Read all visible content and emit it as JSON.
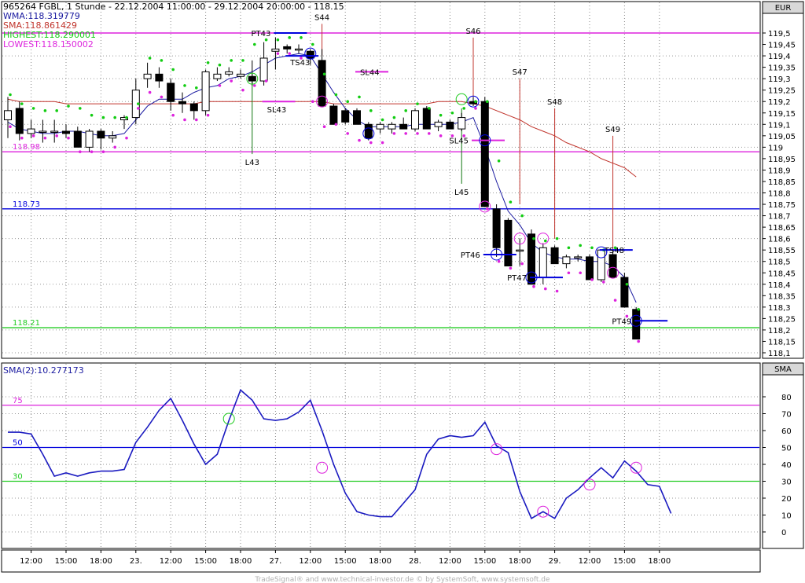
{
  "header": {
    "title": "965264  FGBL, 1 Stunde - 22.12.2004 11:00:00 - 29.12.2004 20:00:00 - 118.15",
    "lines": [
      {
        "text": "WMA:118.319779",
        "color": "#1a1aa0"
      },
      {
        "text": "SMA:118.861429",
        "color": "#c0342c"
      },
      {
        "text": "HIGHEST:118.290001",
        "color": "#11cc11"
      },
      {
        "text": "LOWEST:118.150002",
        "color": "#dd22dd"
      }
    ]
  },
  "panels": {
    "price_currency": "EUR",
    "oscillator_label": "SMA",
    "oscillator_title": "SMA(2):10.277173"
  },
  "footer": {
    "credit": "TradeSignal® and www.technical-investor.de © by SystemSoft, www.systemsoft.de"
  },
  "colors": {
    "wma": "#1a1aa0",
    "sma": "#c0342c",
    "highest": "#11cc11",
    "lowest": "#dd22dd",
    "level_blue": "#0000dd",
    "level_green": "#22cc22",
    "level_magenta": "#dd22dd",
    "signal_line": "#c0342c",
    "candle": "#000000",
    "osc_line": "#1a1ac0"
  },
  "chart_data": [
    {
      "type": "candlestick",
      "title": "965264  FGBL, 1 Stunde - 22.12.2004 11:00:00 - 29.12.2004 20:00:00 - 118.15",
      "ylim": [
        118.1,
        119.55
      ],
      "y_ticks": [
        "119,5",
        "119,45",
        "119,4",
        "119,35",
        "119,3",
        "119,25",
        "119,2",
        "119,15",
        "119,1",
        "119,05",
        "119",
        "118,95",
        "118,9",
        "118,85",
        "118,8",
        "118,75",
        "118,7",
        "118,65",
        "118,6",
        "118,55",
        "118,5",
        "118,45",
        "118,4",
        "118,35",
        "118,3",
        "118,25",
        "118,2",
        "118,15",
        "118,1"
      ],
      "x_ticks": [
        "12:00",
        "15:00",
        "18:00",
        "23.",
        "12:00",
        "15:00",
        "18:00",
        "27.",
        "12:00",
        "15:00",
        "18:00",
        "28.",
        "12:00",
        "15:00",
        "18:00",
        "29.",
        "12:00",
        "15:00",
        "18:00"
      ],
      "x_tick_index": [
        2,
        5,
        8,
        11,
        14,
        17,
        20,
        23,
        26,
        29,
        32,
        35,
        38,
        41,
        44,
        47,
        50,
        53,
        56
      ],
      "candles": [
        {
          "o": 119.12,
          "h": 119.22,
          "l": 119.04,
          "c": 119.16
        },
        {
          "o": 119.17,
          "h": 119.2,
          "l": 119.03,
          "c": 119.06
        },
        {
          "o": 119.06,
          "h": 119.12,
          "l": 119.04,
          "c": 119.08
        },
        {
          "o": 119.07,
          "h": 119.12,
          "l": 119.02,
          "c": 119.07
        },
        {
          "o": 119.07,
          "h": 119.12,
          "l": 119.02,
          "c": 119.07
        },
        {
          "o": 119.07,
          "h": 119.1,
          "l": 119.04,
          "c": 119.06
        },
        {
          "o": 119.07,
          "h": 119.09,
          "l": 119.0,
          "c": 119.0
        },
        {
          "o": 119.0,
          "h": 119.08,
          "l": 118.98,
          "c": 119.07
        },
        {
          "o": 119.07,
          "h": 119.08,
          "l": 118.99,
          "c": 119.04
        },
        {
          "o": 119.04,
          "h": 119.07,
          "l": 119.02,
          "c": 119.05
        },
        {
          "o": 119.12,
          "h": 119.14,
          "l": 119.08,
          "c": 119.13
        },
        {
          "o": 119.13,
          "h": 119.3,
          "l": 119.1,
          "c": 119.25
        },
        {
          "o": 119.3,
          "h": 119.37,
          "l": 119.26,
          "c": 119.32
        },
        {
          "o": 119.32,
          "h": 119.35,
          "l": 119.26,
          "c": 119.29
        },
        {
          "o": 119.28,
          "h": 119.3,
          "l": 119.16,
          "c": 119.2
        },
        {
          "o": 119.2,
          "h": 119.24,
          "l": 119.15,
          "c": 119.19
        },
        {
          "o": 119.19,
          "h": 119.2,
          "l": 119.12,
          "c": 119.16
        },
        {
          "o": 119.16,
          "h": 119.34,
          "l": 119.14,
          "c": 119.33
        },
        {
          "o": 119.3,
          "h": 119.35,
          "l": 119.29,
          "c": 119.32
        },
        {
          "o": 119.32,
          "h": 119.35,
          "l": 119.31,
          "c": 119.33
        },
        {
          "o": 119.31,
          "h": 119.34,
          "l": 119.3,
          "c": 119.32
        },
        {
          "o": 119.31,
          "h": 119.38,
          "l": 119.27,
          "c": 119.29
        },
        {
          "o": 119.29,
          "h": 119.46,
          "l": 119.27,
          "c": 119.39
        },
        {
          "o": 119.42,
          "h": 119.48,
          "l": 119.34,
          "c": 119.43
        },
        {
          "o": 119.44,
          "h": 119.45,
          "l": 119.41,
          "c": 119.43
        },
        {
          "o": 119.43,
          "h": 119.45,
          "l": 119.41,
          "c": 119.43
        },
        {
          "o": 119.42,
          "h": 119.43,
          "l": 119.36,
          "c": 119.39
        },
        {
          "o": 119.38,
          "h": 119.43,
          "l": 119.18,
          "c": 119.18
        },
        {
          "o": 119.18,
          "h": 119.19,
          "l": 119.1,
          "c": 119.1
        },
        {
          "o": 119.16,
          "h": 119.17,
          "l": 119.1,
          "c": 119.11
        },
        {
          "o": 119.16,
          "h": 119.17,
          "l": 119.1,
          "c": 119.1
        },
        {
          "o": 119.1,
          "h": 119.11,
          "l": 119.03,
          "c": 119.04
        },
        {
          "o": 119.08,
          "h": 119.11,
          "l": 119.06,
          "c": 119.1
        },
        {
          "o": 119.08,
          "h": 119.11,
          "l": 119.06,
          "c": 119.1
        },
        {
          "o": 119.1,
          "h": 119.13,
          "l": 119.08,
          "c": 119.08
        },
        {
          "o": 119.08,
          "h": 119.17,
          "l": 119.07,
          "c": 119.16
        },
        {
          "o": 119.17,
          "h": 119.18,
          "l": 119.08,
          "c": 119.08
        },
        {
          "o": 119.09,
          "h": 119.12,
          "l": 119.07,
          "c": 119.11
        },
        {
          "o": 119.11,
          "h": 119.12,
          "l": 119.08,
          "c": 119.08
        },
        {
          "o": 119.08,
          "h": 119.15,
          "l": 119.07,
          "c": 119.13
        },
        {
          "o": 119.2,
          "h": 119.22,
          "l": 119.18,
          "c": 119.19
        },
        {
          "o": 119.2,
          "h": 119.22,
          "l": 118.74,
          "c": 118.74
        },
        {
          "o": 118.73,
          "h": 118.75,
          "l": 118.52,
          "c": 118.56
        },
        {
          "o": 118.68,
          "h": 118.69,
          "l": 118.48,
          "c": 118.48
        },
        {
          "o": 118.55,
          "h": 118.6,
          "l": 118.48,
          "c": 118.55
        },
        {
          "o": 118.62,
          "h": 118.64,
          "l": 118.4,
          "c": 118.4
        },
        {
          "o": 118.43,
          "h": 118.58,
          "l": 118.4,
          "c": 118.56
        },
        {
          "o": 118.56,
          "h": 118.57,
          "l": 118.49,
          "c": 118.49
        },
        {
          "o": 118.49,
          "h": 118.53,
          "l": 118.47,
          "c": 118.52
        },
        {
          "o": 118.52,
          "h": 118.53,
          "l": 118.5,
          "c": 118.52
        },
        {
          "o": 118.52,
          "h": 118.53,
          "l": 118.42,
          "c": 118.42
        },
        {
          "o": 118.42,
          "h": 118.55,
          "l": 118.41,
          "c": 118.55
        },
        {
          "o": 118.53,
          "h": 118.55,
          "l": 118.43,
          "c": 118.43
        },
        {
          "o": 118.43,
          "h": 118.45,
          "l": 118.3,
          "c": 118.3
        },
        {
          "o": 118.29,
          "h": 118.3,
          "l": 118.16,
          "c": 118.16
        }
      ],
      "series": [
        {
          "name": "WMA:118.319779",
          "values": [
            119.11,
            119.08,
            119.07,
            119.06,
            119.06,
            119.07,
            119.07,
            119.06,
            119.05,
            119.05,
            119.06,
            119.12,
            119.18,
            119.21,
            119.21,
            119.21,
            119.24,
            119.26,
            119.27,
            119.3,
            119.31,
            119.33,
            119.36,
            119.39,
            119.4,
            119.41,
            119.4,
            119.32,
            119.24,
            119.17,
            119.12,
            119.09,
            119.09,
            119.09,
            119.09,
            119.1,
            119.1,
            119.1,
            119.1,
            119.11,
            119.13,
            119.0,
            118.85,
            118.72,
            118.66,
            118.58,
            118.54,
            118.52,
            118.51,
            118.51,
            118.5,
            118.5,
            118.48,
            118.43,
            118.32
          ]
        },
        {
          "name": "SMA:118.861429",
          "values": [
            119.21,
            119.2,
            119.2,
            119.2,
            119.2,
            119.19,
            119.19,
            119.19,
            119.19,
            119.19,
            119.19,
            119.19,
            119.19,
            119.19,
            119.19,
            119.19,
            119.19,
            119.2,
            119.2,
            119.2,
            119.2,
            119.2,
            119.2,
            119.2,
            119.2,
            119.2,
            119.2,
            119.2,
            119.19,
            119.19,
            119.19,
            119.19,
            119.19,
            119.19,
            119.19,
            119.19,
            119.19,
            119.2,
            119.2,
            119.2,
            119.19,
            119.18,
            119.16,
            119.14,
            119.12,
            119.09,
            119.07,
            119.05,
            119.02,
            119.0,
            118.98,
            118.95,
            118.93,
            118.91,
            118.87
          ]
        },
        {
          "name": "HIGHEST:118.290001",
          "values": [
            119.23,
            119.19,
            119.17,
            119.16,
            119.16,
            119.18,
            119.17,
            119.14,
            119.13,
            119.13,
            119.13,
            119.19,
            119.39,
            119.38,
            119.34,
            119.27,
            119.26,
            119.37,
            119.36,
            119.38,
            119.38,
            119.45,
            119.47,
            119.47,
            119.48,
            119.48,
            119.45,
            119.32,
            119.23,
            119.2,
            119.22,
            119.16,
            119.12,
            119.13,
            119.16,
            119.19,
            119.17,
            119.14,
            119.15,
            119.17,
            119.2,
            119.2,
            118.94,
            118.76,
            118.7,
            118.6,
            118.59,
            118.6,
            118.56,
            118.57,
            118.56,
            118.55,
            118.56,
            118.4,
            118.29
          ]
        },
        {
          "name": "LOWEST:118.150002",
          "values": [
            119.09,
            119.04,
            119.05,
            119.04,
            119.05,
            119.04,
            118.98,
            118.98,
            118.98,
            119.0,
            119.04,
            119.17,
            119.24,
            119.22,
            119.14,
            119.12,
            119.12,
            119.14,
            119.27,
            119.29,
            119.25,
            119.27,
            119.29,
            119.41,
            119.41,
            119.39,
            119.2,
            119.09,
            119.1,
            119.06,
            119.03,
            119.02,
            119.02,
            119.06,
            119.06,
            119.06,
            119.06,
            119.05,
            119.05,
            119.05,
            119.17,
            118.73,
            118.5,
            118.47,
            118.49,
            118.39,
            118.38,
            118.37,
            118.45,
            118.45,
            118.42,
            118.41,
            118.33,
            118.26,
            118.15
          ]
        }
      ],
      "levels": [
        {
          "value": 119.5,
          "color": "#dd22dd",
          "label": "119.5"
        },
        {
          "value": 118.98,
          "color": "#dd22dd",
          "label": "118.98"
        },
        {
          "value": 118.73,
          "color": "#0000dd",
          "label": "118.73"
        },
        {
          "value": 118.21,
          "color": "#22cc22",
          "label": "118.21"
        }
      ],
      "signals": [
        {
          "label": "S44",
          "bar": 27,
          "top": 119.54,
          "bottom": 119.4
        },
        {
          "label": "S46",
          "bar": 40,
          "top": 119.48,
          "bottom": 119.2
        },
        {
          "label": "S47",
          "bar": 44,
          "top": 119.3,
          "bottom": 118.75
        },
        {
          "label": "S48",
          "bar": 47,
          "top": 119.17,
          "bottom": 118.6
        },
        {
          "label": "S49",
          "bar": 52,
          "top": 119.05,
          "bottom": 118.55
        }
      ],
      "long_markers": [
        {
          "label": "L43",
          "bar": 21,
          "top": 119.32,
          "bottom": 118.97
        },
        {
          "label": "L45",
          "bar": 39,
          "top": 119.17,
          "bottom": 118.84
        }
      ],
      "marks": [
        {
          "label": "PT43",
          "bar": 23,
          "value": 119.5,
          "color": "#0000dd"
        },
        {
          "label": "TS43",
          "bar": 24,
          "value": 119.4,
          "color": "#0000dd"
        },
        {
          "label": "SL43",
          "bar": 22,
          "value": 119.2,
          "color": "#dd22dd"
        },
        {
          "label": "SL44",
          "bar": 30,
          "value": 119.33,
          "color": "#dd22dd"
        },
        {
          "label": "SL45",
          "bar": 40,
          "value": 119.03,
          "color": "#dd22dd"
        },
        {
          "label": "PT46",
          "bar": 41,
          "value": 118.53,
          "color": "#0000dd"
        },
        {
          "label": "PT47",
          "bar": 45,
          "value": 118.43,
          "color": "#0000dd"
        },
        {
          "label": "TS48",
          "bar": 51,
          "value": 118.55,
          "color": "#0000dd"
        },
        {
          "label": "PT49",
          "bar": 54,
          "value": 118.24,
          "color": "#0000dd"
        }
      ],
      "circles": [
        {
          "bar": 21,
          "value": 119.3,
          "color": "#22cc22"
        },
        {
          "bar": 26,
          "value": 119.41,
          "color": "#0000dd"
        },
        {
          "bar": 27,
          "value": 119.2,
          "color": "#dd22dd"
        },
        {
          "bar": 31,
          "value": 119.06,
          "color": "#0000dd"
        },
        {
          "bar": 39,
          "value": 119.21,
          "color": "#22cc22"
        },
        {
          "bar": 40,
          "value": 119.2,
          "color": "#0000dd"
        },
        {
          "bar": 41,
          "value": 119.03,
          "color": "#0000dd"
        },
        {
          "bar": 41,
          "value": 118.74,
          "color": "#dd22dd"
        },
        {
          "bar": 42,
          "value": 118.53,
          "color": "#0000dd"
        },
        {
          "bar": 44,
          "value": 118.6,
          "color": "#dd22dd"
        },
        {
          "bar": 45,
          "value": 118.43,
          "color": "#0000dd"
        },
        {
          "bar": 46,
          "value": 118.6,
          "color": "#dd22dd"
        },
        {
          "bar": 51,
          "value": 118.54,
          "color": "#0000dd"
        },
        {
          "bar": 52,
          "value": 118.45,
          "color": "#dd22dd"
        },
        {
          "bar": 54,
          "value": 118.24,
          "color": "#0000dd"
        }
      ]
    },
    {
      "type": "line",
      "title": "SMA(2):10.277173",
      "ylim": [
        -7,
        90
      ],
      "y_ticks": [
        0,
        10,
        20,
        30,
        40,
        50,
        60,
        70,
        80
      ],
      "levels": [
        {
          "value": 75,
          "color": "#dd22dd",
          "label": "75"
        },
        {
          "value": 50,
          "color": "#0000dd",
          "label": "50"
        },
        {
          "value": 30,
          "color": "#22cc22",
          "label": "30"
        }
      ],
      "series": [
        {
          "name": "SMA(2):10.277173",
          "values": [
            59,
            59,
            58,
            46,
            33,
            35,
            33,
            35,
            36,
            36,
            37,
            53,
            62,
            72,
            79,
            66,
            52,
            40,
            46,
            66,
            84,
            78,
            67,
            66,
            67,
            71,
            78,
            60,
            40,
            23,
            12,
            10,
            9,
            9,
            17,
            25,
            46,
            55,
            57,
            56,
            57,
            65,
            51,
            47,
            24,
            8,
            12,
            8,
            20,
            25,
            32,
            38,
            32,
            42,
            36,
            28,
            27,
            11
          ]
        },
        {
          "name": "",
          "values": []
        }
      ],
      "circles": [
        {
          "index": 19,
          "value": 67,
          "color": "#22cc22"
        },
        {
          "index": 27,
          "value": 38,
          "color": "#dd22dd"
        },
        {
          "index": 42,
          "value": 49,
          "color": "#dd22dd"
        },
        {
          "index": 46,
          "value": 12,
          "color": "#dd22dd"
        },
        {
          "index": 50,
          "value": 28,
          "color": "#dd22dd"
        },
        {
          "index": 54,
          "value": 38,
          "color": "#dd22dd"
        }
      ]
    }
  ]
}
